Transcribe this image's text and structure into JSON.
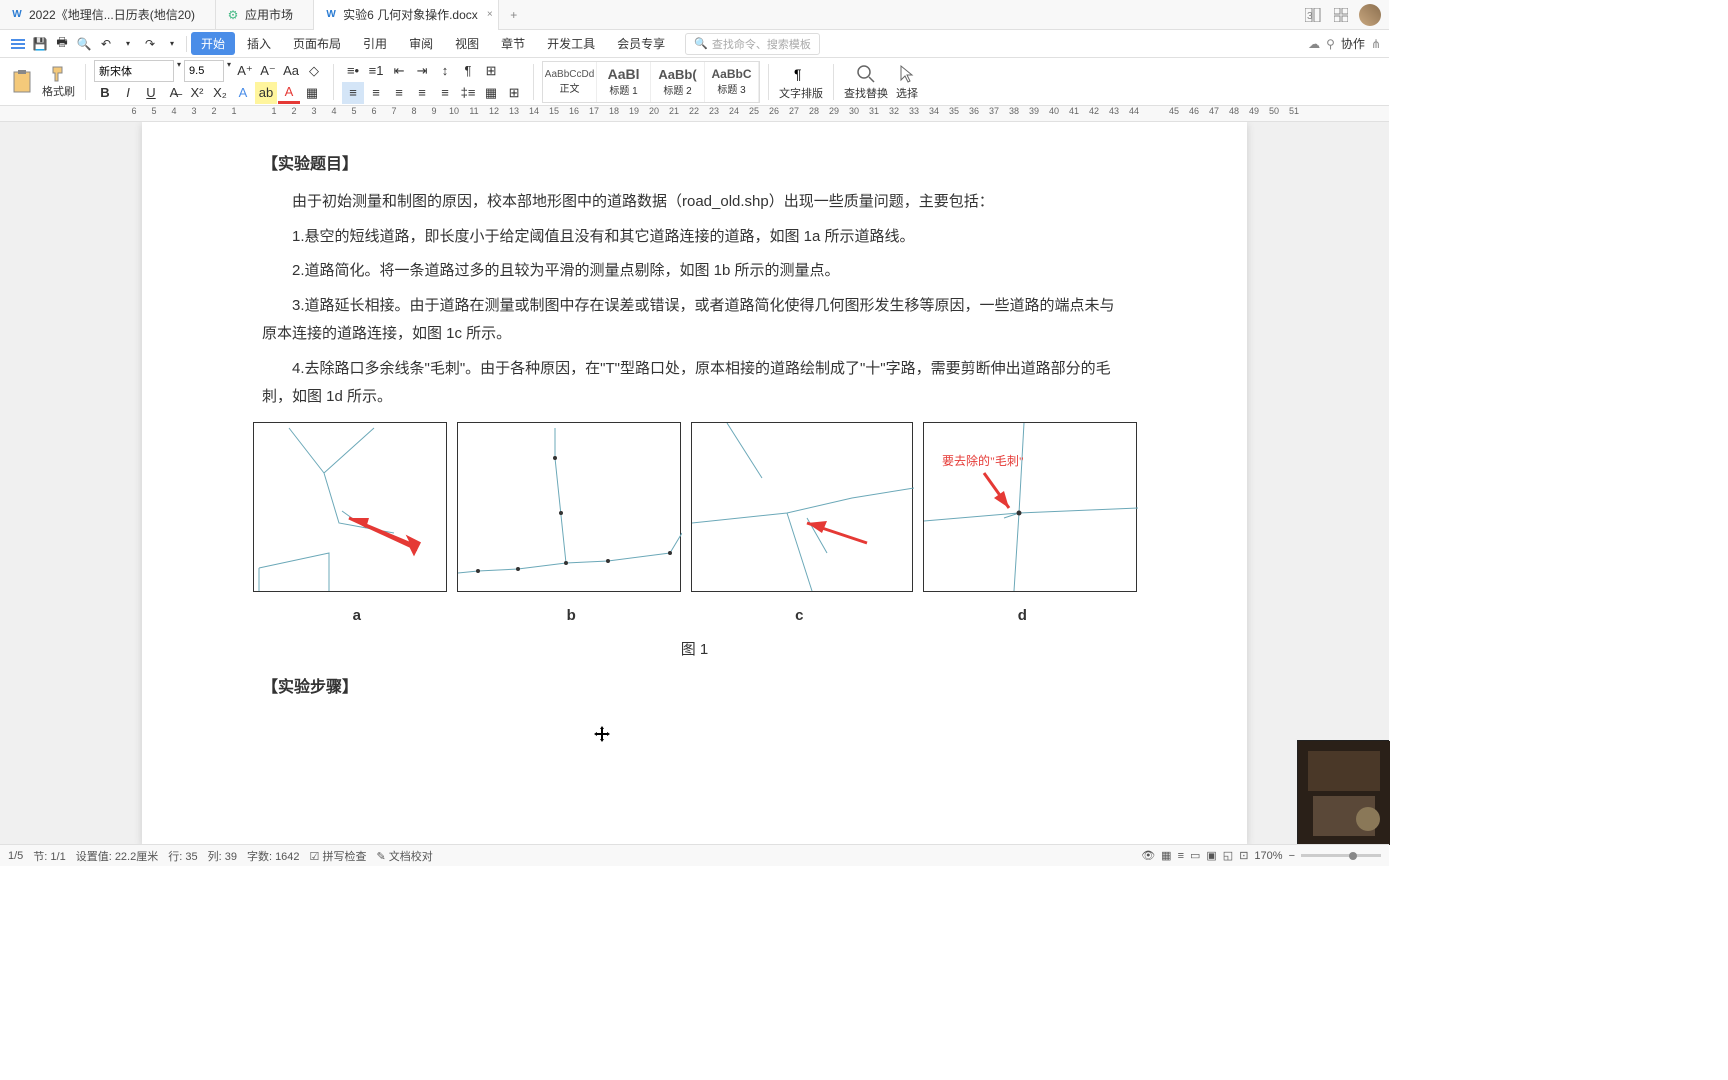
{
  "tabs": [
    {
      "label": "2022《地理信...日历表(地信20)",
      "icon": "W"
    },
    {
      "label": "应用市场",
      "icon": "⚙"
    },
    {
      "label": "实验6 几何对象操作.docx",
      "icon": "W",
      "active": true
    }
  ],
  "titlebar_icons": {
    "grid1": "⊞",
    "grid2": "⊞"
  },
  "menu": {
    "tabs": [
      "开始",
      "插入",
      "页面布局",
      "引用",
      "审阅",
      "视图",
      "章节",
      "开发工具",
      "会员专享"
    ],
    "active": "开始",
    "search_placeholder": "查找命令、搜索模板"
  },
  "ribbon": {
    "format_painter": "格式刷",
    "font": "新宋体",
    "size": "9.5",
    "bold": "B",
    "italic": "I",
    "underline": "U",
    "strikethrough": "A",
    "super": "X²",
    "sub": "X₂",
    "textfx": "A",
    "styles": [
      {
        "preview": "AaBbCcDd",
        "name": "正文"
      },
      {
        "preview": "AaBl",
        "name": "标题 1"
      },
      {
        "preview": "AaBb(",
        "name": "标题 2"
      },
      {
        "preview": "AaBbC",
        "name": "标题 3"
      }
    ],
    "text_layout": "文字排版",
    "find_replace": "查找替换",
    "select": "选择",
    "collab": "协作"
  },
  "ruler_marks": [
    "6",
    "5",
    "4",
    "3",
    "2",
    "1",
    "",
    "1",
    "2",
    "3",
    "4",
    "5",
    "6",
    "7",
    "8",
    "9",
    "10",
    "11",
    "12",
    "13",
    "14",
    "15",
    "16",
    "17",
    "18",
    "19",
    "20",
    "21",
    "22",
    "23",
    "24",
    "25",
    "26",
    "27",
    "28",
    "29",
    "30",
    "31",
    "32",
    "33",
    "34",
    "35",
    "36",
    "37",
    "38",
    "39",
    "40",
    "41",
    "42",
    "43",
    "44",
    "",
    "45",
    "46",
    "47",
    "48",
    "49",
    "50",
    "51"
  ],
  "doc": {
    "heading1": "【实验题目】",
    "p1": "由于初始测量和制图的原因，校本部地形图中的道路数据（road_old.shp）出现一些质量问题，主要包括：",
    "p2": "1.悬空的短线道路，即长度小于给定阈值且没有和其它道路连接的道路，如图 1a 所示道路线。",
    "p3": "2.道路简化。将一条道路过多的且较为平滑的测量点剔除，如图 1b 所示的测量点。",
    "p4": "3.道路延长相接。由于道路在测量或制图中存在误差或错误，或者道路简化使得几何图形发生移等原因，一些道路的端点未与原本连接的道路连接，如图 1c 所示。",
    "p5": "4.去除路口多余线条\"毛刺\"。由于各种原因，在\"T\"型路口处，原本相接的道路绘制成了\"十\"字路，需要剪断伸出道路部分的毛刺，如图 1d 所示。",
    "fig_labels": {
      "a": "a",
      "b": "b",
      "c": "c",
      "d": "d"
    },
    "fig_text_d": "要去除的\"毛刺\"",
    "caption": "图 1",
    "heading2": "【实验步骤】"
  },
  "status": {
    "page": "1/5",
    "section": "节: 1/1",
    "pos": "设置值: 22.2厘米",
    "row": "行: 35",
    "col": "列: 39",
    "words": "字数: 1642",
    "spell": "拼写检查",
    "proof": "文档校对",
    "zoom": "170%"
  }
}
